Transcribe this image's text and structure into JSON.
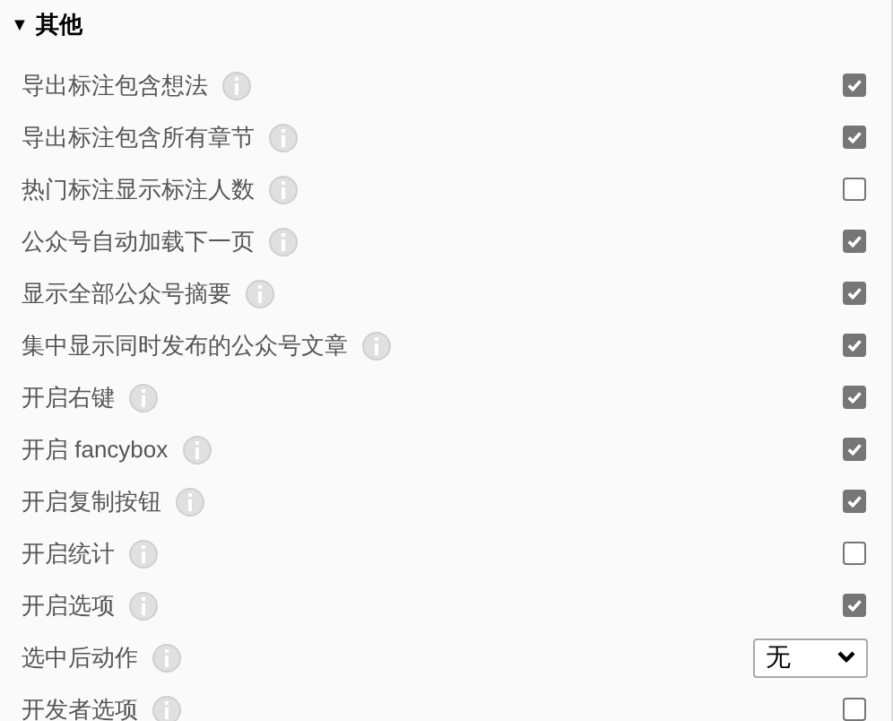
{
  "section": {
    "toggle": "▼",
    "title": "其他",
    "expanded": true
  },
  "settings": [
    {
      "kind": "checkbox",
      "label": "导出标注包含想法",
      "checked": true
    },
    {
      "kind": "checkbox",
      "label": "导出标注包含所有章节",
      "checked": true
    },
    {
      "kind": "checkbox",
      "label": "热门标注显示标注人数",
      "checked": false
    },
    {
      "kind": "checkbox",
      "label": "公众号自动加载下一页",
      "checked": true
    },
    {
      "kind": "checkbox",
      "label": "显示全部公众号摘要",
      "checked": true
    },
    {
      "kind": "checkbox",
      "label": "集中显示同时发布的公众号文章",
      "checked": true
    },
    {
      "kind": "checkbox",
      "label": "开启右键",
      "checked": true
    },
    {
      "kind": "checkbox",
      "label": "开启 fancybox",
      "checked": true
    },
    {
      "kind": "checkbox",
      "label": "开启复制按钮",
      "checked": true
    },
    {
      "kind": "checkbox",
      "label": "开启统计",
      "checked": false
    },
    {
      "kind": "checkbox",
      "label": "开启选项",
      "checked": true
    },
    {
      "kind": "select",
      "label": "选中后动作",
      "value": "无"
    },
    {
      "kind": "checkbox",
      "label": "开发者选项",
      "checked": false
    }
  ]
}
